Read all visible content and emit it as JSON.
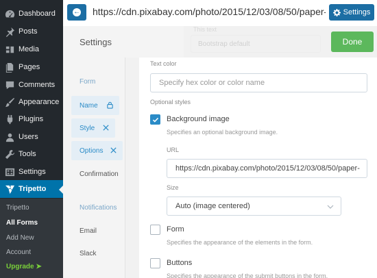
{
  "wp_menu": {
    "items": [
      {
        "label": "Dashboard",
        "icon": "dashboard-icon"
      },
      {
        "label": "Posts",
        "icon": "pin-icon"
      },
      {
        "label": "Media",
        "icon": "media-icon"
      },
      {
        "label": "Pages",
        "icon": "pages-icon"
      },
      {
        "label": "Comments",
        "icon": "comment-icon"
      },
      {
        "label": "Appearance",
        "icon": "brush-icon"
      },
      {
        "label": "Plugins",
        "icon": "plugin-icon"
      },
      {
        "label": "Users",
        "icon": "users-icon"
      },
      {
        "label": "Tools",
        "icon": "wrench-icon"
      },
      {
        "label": "Settings",
        "icon": "settings-icon"
      },
      {
        "label": "Tripetto",
        "icon": "tripetto-icon"
      }
    ],
    "submenu": [
      "Tripetto",
      "All Forms",
      "Add New",
      "Account",
      "Upgrade ➤"
    ]
  },
  "topbar": {
    "url": "https://cdn.pixabay.com/photo/2015/12/03/08/50/paper-",
    "settings_label": "Settings"
  },
  "background_preview": {
    "title": "This text",
    "select_value": "Bootstrap default"
  },
  "panel": {
    "title": "Settings",
    "done_label": "Done",
    "nav": {
      "form_heading": "Form",
      "name": "Name",
      "style": "Style",
      "options": "Options",
      "confirmation": "Confirmation",
      "notifications_heading": "Notifications",
      "email": "Email",
      "slack": "Slack"
    },
    "content": {
      "text_color_label": "Text color",
      "text_color_placeholder": "Specify hex color or color name",
      "optional_styles_label": "Optional styles",
      "background_image": {
        "label": "Background image",
        "description": "Specifies an optional background image.",
        "checked": true,
        "url_label": "URL",
        "url_value": "https://cdn.pixabay.com/photo/2015/12/03/08/50/paper-",
        "size_label": "Size",
        "size_value": "Auto (image centered)"
      },
      "form_option": {
        "label": "Form",
        "description": "Specifies the appearance of the elements in the form.",
        "checked": false
      },
      "buttons_option": {
        "label": "Buttons",
        "description": "Specifies the appearance of the submit buttons in the form.",
        "checked": false
      }
    }
  },
  "colors": {
    "wp_sidebar": "#23282d",
    "wp_active": "#0073aa",
    "primary": "#1c6ea4",
    "done_green": "#5cb85c",
    "checkbox_blue": "#2a8bc7"
  }
}
